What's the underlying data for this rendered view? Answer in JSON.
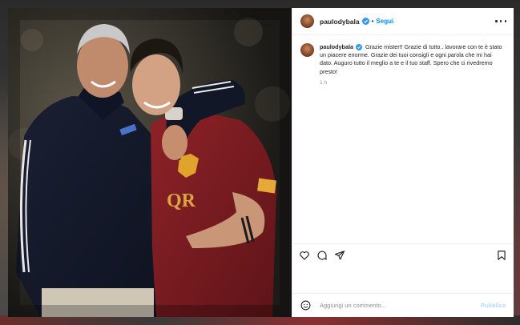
{
  "post": {
    "username": "paulodybala",
    "follow_label": "Segui",
    "separator": "•",
    "caption": "Grazie mister!! Grazie di tutto.. lavorare con te è stato un piacere enorme. Grazie dei tuoi consigli e ogni parola che mi hai dato. Auguro tutto il meglio a te e il tuo staff. Spero che ci rivedremo presto!",
    "time": "1 h"
  },
  "media": {
    "jersey_text": "QR"
  },
  "comment_box": {
    "placeholder": "Aggiungi un commento...",
    "publish_label": "Pubblica"
  },
  "colors": {
    "link_blue": "#0095f6",
    "publish_disabled": "#b3dbff",
    "verified_blue": "#3897f0",
    "jersey_red": "#7d1d22"
  },
  "icons": {
    "like": "heart-icon",
    "comment": "comment-icon",
    "share": "share-icon",
    "save": "bookmark-icon",
    "emoji": "emoji-icon",
    "options": "more-options-icon"
  }
}
